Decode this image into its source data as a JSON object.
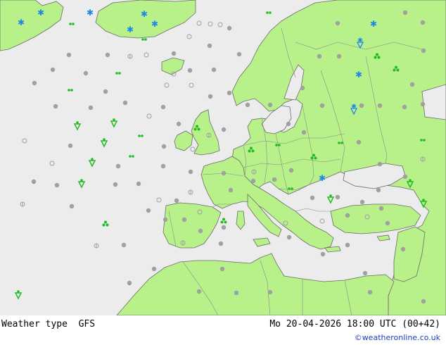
{
  "map": {
    "product_label": "Weather type",
    "model": "GFS",
    "valid_time": "Mo 20-04-2026 18:00 UTC (00+42)",
    "credit": "©weatheronline.co.uk"
  },
  "colors": {
    "sea": "#ececec",
    "land": "#b8f08a",
    "border": "#8a8a8a",
    "coast": "#6a6a6a",
    "symbol_gray": "#a0a0a0",
    "symbol_green": "#22bb22",
    "symbol_blue": "#1e88e5"
  },
  "symbols": {
    "types": [
      "cloud-dot",
      "light-rain",
      "rain",
      "drizzle",
      "showers",
      "snow",
      "snow-shower"
    ]
  }
}
